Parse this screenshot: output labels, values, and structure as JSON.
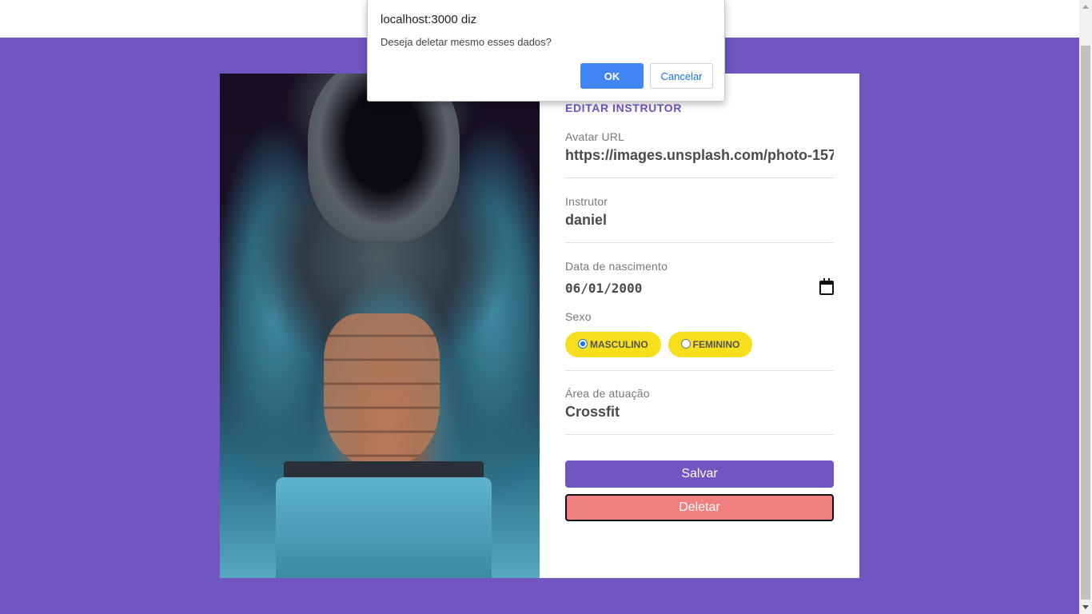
{
  "dialog": {
    "title": "localhost:3000 diz",
    "message": "Deseja deletar mesmo esses dados?",
    "ok_label": "OK",
    "cancel_label": "Cancelar"
  },
  "form": {
    "title": "EDITAR INSTRUTOR",
    "avatar": {
      "label": "Avatar URL",
      "value": "https://images.unsplash.com/photo-157"
    },
    "instructor": {
      "label": "Instrutor",
      "value": "daniel"
    },
    "birth": {
      "label": "Data de nascimento",
      "value": "06/01/2000"
    },
    "gender": {
      "label": "Sexo",
      "options": [
        {
          "label": "MASCULINO",
          "checked": true
        },
        {
          "label": "FEMININO",
          "checked": false
        }
      ]
    },
    "area": {
      "label": "Área de atuação",
      "value": "Crossfit"
    },
    "save_label": "Salvar",
    "delete_label": "Deletar"
  },
  "colors": {
    "background": "#7156c2",
    "accent": "#7156c2",
    "pill": "#f7df1e",
    "delete": "#f07f7f",
    "dialog_ok": "#4285f4"
  },
  "icons": [
    "calendar-icon",
    "radio-icon"
  ]
}
